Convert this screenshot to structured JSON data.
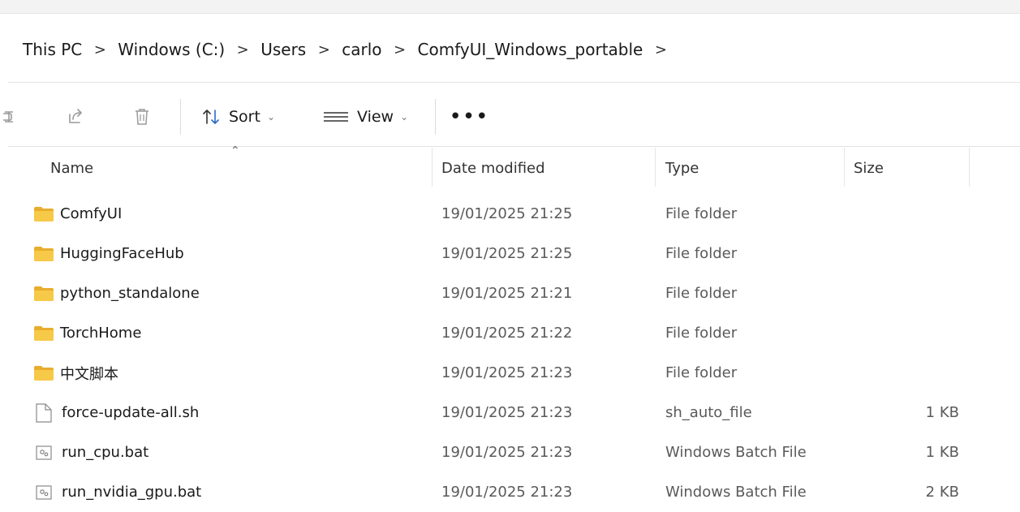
{
  "breadcrumb": {
    "items": [
      "This PC",
      "Windows (C:)",
      "Users",
      "carlo",
      "ComfyUI_Windows_portable"
    ],
    "separator": ">"
  },
  "toolbar": {
    "sort_label": "Sort",
    "view_label": "View",
    "more_label": "•••"
  },
  "columns": {
    "name": "Name",
    "date": "Date modified",
    "type": "Type",
    "size": "Size"
  },
  "files": [
    {
      "name": "ComfyUI",
      "date": "19/01/2025 21:25",
      "type": "File folder",
      "size": "",
      "icon": "folder-icon"
    },
    {
      "name": "HuggingFaceHub",
      "date": "19/01/2025 21:25",
      "type": "File folder",
      "size": "",
      "icon": "folder-icon"
    },
    {
      "name": "python_standalone",
      "date": "19/01/2025 21:21",
      "type": "File folder",
      "size": "",
      "icon": "folder-icon"
    },
    {
      "name": "TorchHome",
      "date": "19/01/2025 21:22",
      "type": "File folder",
      "size": "",
      "icon": "folder-icon"
    },
    {
      "name": "中文脚本",
      "date": "19/01/2025 21:23",
      "type": "File folder",
      "size": "",
      "icon": "folder-icon"
    },
    {
      "name": "force-update-all.sh",
      "date": "19/01/2025 21:23",
      "type": "sh_auto_file",
      "size": "1 KB",
      "icon": "file-icon"
    },
    {
      "name": "run_cpu.bat",
      "date": "19/01/2025 21:23",
      "type": "Windows Batch File",
      "size": "1 KB",
      "icon": "batch-file-icon"
    },
    {
      "name": "run_nvidia_gpu.bat",
      "date": "19/01/2025 21:23",
      "type": "Windows Batch File",
      "size": "2 KB",
      "icon": "batch-file-icon"
    }
  ],
  "colors": {
    "folder": "#f2c14e",
    "folder_dark": "#e0a82e",
    "divider": "#e3e3e3"
  }
}
